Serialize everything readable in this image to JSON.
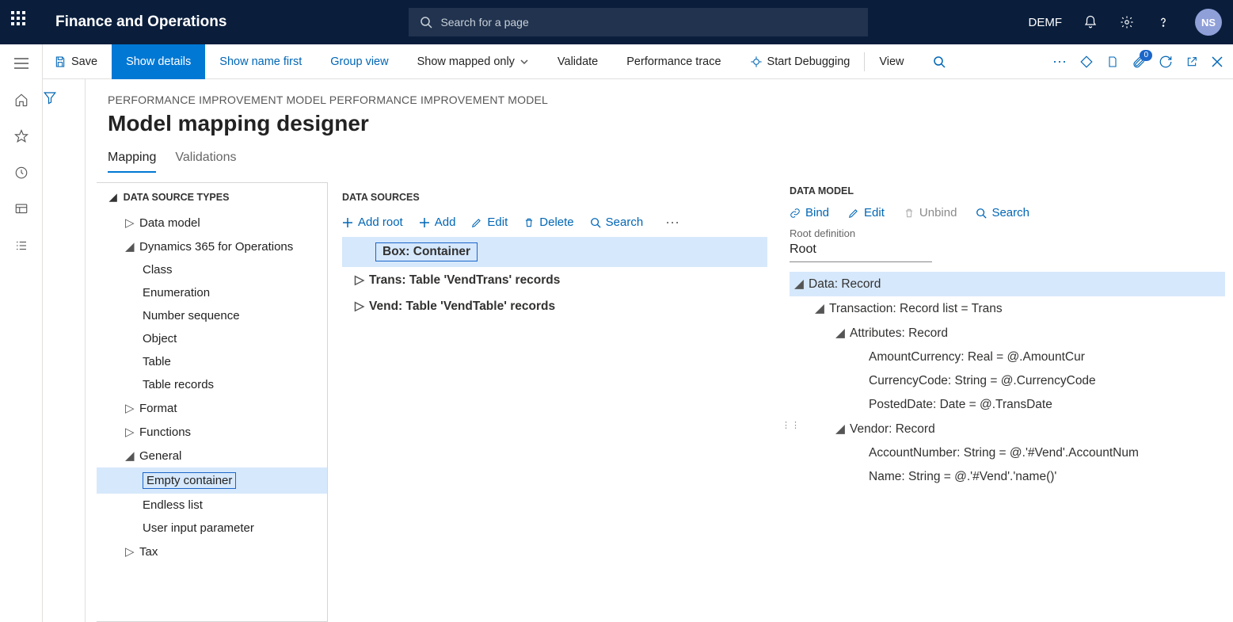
{
  "header": {
    "app_title": "Finance and Operations",
    "search_placeholder": "Search for a page",
    "company": "DEMF",
    "avatar": "NS"
  },
  "toolbar": {
    "save": "Save",
    "show_details": "Show details",
    "show_name_first": "Show name first",
    "group_view": "Group view",
    "show_mapped_only": "Show mapped only",
    "validate": "Validate",
    "perf_trace": "Performance trace",
    "start_debugging": "Start Debugging",
    "view": "View",
    "badge_count": "0"
  },
  "page": {
    "breadcrumb": "PERFORMANCE IMPROVEMENT MODEL PERFORMANCE IMPROVEMENT MODEL",
    "title": "Model mapping designer",
    "tabs": {
      "mapping": "Mapping",
      "validations": "Validations"
    }
  },
  "panel1": {
    "title": "DATA SOURCE TYPES",
    "tree": {
      "data_model": "Data model",
      "d365": "Dynamics 365 for Operations",
      "class": "Class",
      "enumeration": "Enumeration",
      "number_sequence": "Number sequence",
      "object": "Object",
      "table": "Table",
      "table_records": "Table records",
      "format": "Format",
      "functions": "Functions",
      "general": "General",
      "empty_container": "Empty container",
      "endless_list": "Endless list",
      "user_input_parameter": "User input parameter",
      "tax": "Tax"
    }
  },
  "panel2": {
    "title": "DATA SOURCES",
    "actions": {
      "add_root": "Add root",
      "add": "Add",
      "edit": "Edit",
      "delete": "Delete",
      "search": "Search"
    },
    "rows": {
      "box": "Box: Container",
      "trans": "Trans: Table 'VendTrans' records",
      "vend": "Vend: Table 'VendTable' records"
    }
  },
  "panel3": {
    "title": "DATA MODEL",
    "actions": {
      "bind": "Bind",
      "edit": "Edit",
      "unbind": "Unbind",
      "search": "Search"
    },
    "root_def_label": "Root definition",
    "root_def_value": "Root",
    "rows": {
      "data": "Data: Record",
      "transaction": "Transaction: Record list = Trans",
      "attributes": "Attributes: Record",
      "amount": "AmountCurrency: Real = @.AmountCur",
      "currency": "CurrencyCode: String = @.CurrencyCode",
      "posted": "PostedDate: Date = @.TransDate",
      "vendor": "Vendor: Record",
      "account": "AccountNumber: String = @.'#Vend'.AccountNum",
      "name": "Name: String = @.'#Vend'.'name()'"
    }
  }
}
